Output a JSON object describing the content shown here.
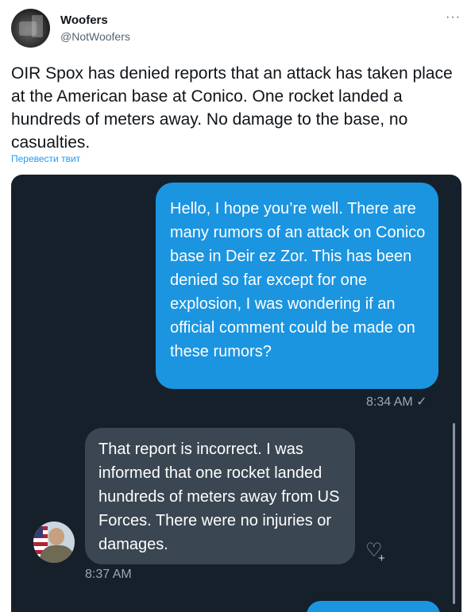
{
  "user": {
    "display_name": "Woofers",
    "handle": "@NotWoofers"
  },
  "tweet": {
    "text": "OIR Spox has denied reports that an attack has taken place at the American base at Conico. One rocket landed a hundreds of meters away. No damage to the base, no casualties.",
    "translate_label": "Перевести твит",
    "more_label": "···"
  },
  "conversation": {
    "outgoing_message": "Hello, I hope you’re well. There are many rumors of an attack on Conico base in Deir ez Zor. This has been denied so far except for one explosion, I was wondering if an official comment could be made on these rumors?",
    "outgoing_time": "8:34 AM ✓",
    "incoming_message": "That report is incorrect. I was informed that one rocket landed hundreds of meters away from US Forces. There were no injuries or damages.",
    "incoming_time": "8:37 AM",
    "react_icon": "heart-plus"
  },
  "colors": {
    "outgoing_bubble": "#1b95e0",
    "incoming_bubble": "#3a4651",
    "media_background": "#16202b",
    "link": "#1d9bf0"
  }
}
